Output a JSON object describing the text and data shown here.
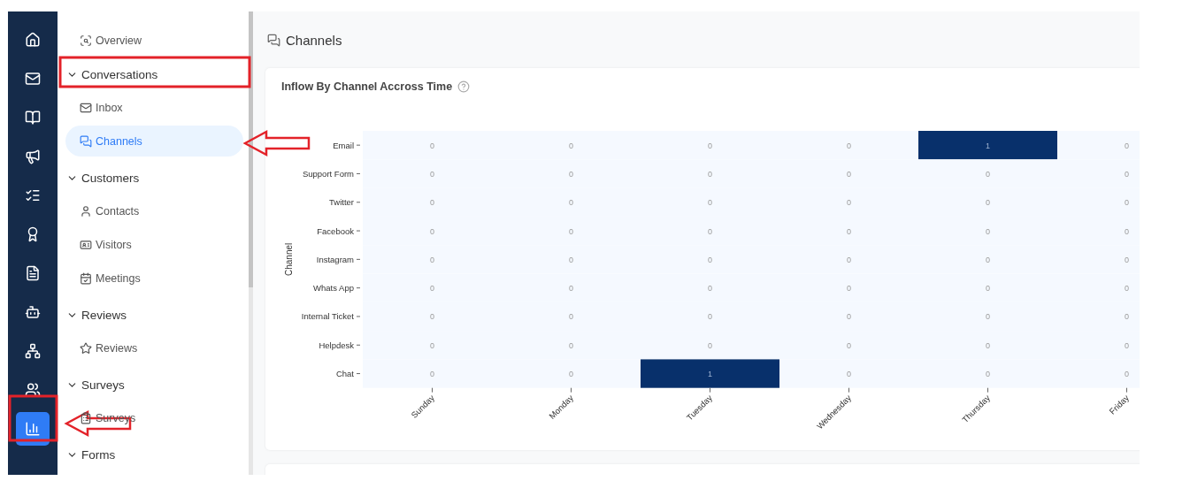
{
  "rail": {
    "items": [
      {
        "selected": false
      },
      {
        "selected": false
      },
      {
        "selected": false
      },
      {
        "selected": false
      },
      {
        "selected": false
      },
      {
        "selected": false
      },
      {
        "selected": false
      },
      {
        "selected": false
      },
      {
        "selected": false
      },
      {
        "selected": false
      },
      {
        "selected": true
      }
    ]
  },
  "sidebar": {
    "top_item": {
      "label": "Overview",
      "selected": false
    },
    "sections": [
      {
        "title": "Conversations",
        "expanded": true,
        "items": [
          {
            "label": "Inbox",
            "selected": false
          },
          {
            "label": "Channels",
            "selected": true
          }
        ]
      },
      {
        "title": "Customers",
        "expanded": true,
        "items": [
          {
            "label": "Contacts",
            "selected": false
          },
          {
            "label": "Visitors",
            "selected": false
          },
          {
            "label": "Meetings",
            "selected": false
          }
        ]
      },
      {
        "title": "Reviews",
        "expanded": true,
        "items": [
          {
            "label": "Reviews",
            "selected": false
          }
        ]
      },
      {
        "title": "Surveys",
        "expanded": true,
        "items": [
          {
            "label": "Surveys",
            "selected": false
          }
        ]
      },
      {
        "title": "Forms",
        "expanded": true
      }
    ]
  },
  "page": {
    "title": "Channels"
  },
  "card": {
    "title": "Inflow By Channel Accross Time",
    "heatmap": {
      "y_axis_title": "Channel",
      "x_axis_labels": [
        "Sunday",
        "Monday",
        "Tuesday",
        "Wednesday",
        "Thursday",
        "Friday"
      ],
      "rows": [
        {
          "label": "Email",
          "cells": [
            {
              "value": "0",
              "color": "#f5f9ff"
            },
            {
              "value": "0",
              "color": "#f5f9ff"
            },
            {
              "value": "0",
              "color": "#f5f9ff"
            },
            {
              "value": "0",
              "color": "#f5f9ff"
            },
            {
              "value": "1",
              "color": "#08306b"
            },
            {
              "value": "0",
              "color": "#f5f9ff"
            }
          ]
        },
        {
          "label": "Support Form",
          "cells": [
            {
              "value": "0",
              "color": "#f5f9ff"
            },
            {
              "value": "0",
              "color": "#f5f9ff"
            },
            {
              "value": "0",
              "color": "#f5f9ff"
            },
            {
              "value": "0",
              "color": "#f5f9ff"
            },
            {
              "value": "0",
              "color": "#f5f9ff"
            },
            {
              "value": "0",
              "color": "#f5f9ff"
            }
          ]
        },
        {
          "label": "Twitter",
          "cells": [
            {
              "value": "0",
              "color": "#f5f9ff"
            },
            {
              "value": "0",
              "color": "#f5f9ff"
            },
            {
              "value": "0",
              "color": "#f5f9ff"
            },
            {
              "value": "0",
              "color": "#f5f9ff"
            },
            {
              "value": "0",
              "color": "#f5f9ff"
            },
            {
              "value": "0",
              "color": "#f5f9ff"
            }
          ]
        },
        {
          "label": "Facebook",
          "cells": [
            {
              "value": "0",
              "color": "#f5f9ff"
            },
            {
              "value": "0",
              "color": "#f5f9ff"
            },
            {
              "value": "0",
              "color": "#f5f9ff"
            },
            {
              "value": "0",
              "color": "#f5f9ff"
            },
            {
              "value": "0",
              "color": "#f5f9ff"
            },
            {
              "value": "0",
              "color": "#f5f9ff"
            }
          ]
        },
        {
          "label": "Instagram",
          "cells": [
            {
              "value": "0",
              "color": "#f5f9ff"
            },
            {
              "value": "0",
              "color": "#f5f9ff"
            },
            {
              "value": "0",
              "color": "#f5f9ff"
            },
            {
              "value": "0",
              "color": "#f5f9ff"
            },
            {
              "value": "0",
              "color": "#f5f9ff"
            },
            {
              "value": "0",
              "color": "#f5f9ff"
            }
          ]
        },
        {
          "label": "Whats App",
          "cells": [
            {
              "value": "0",
              "color": "#f5f9ff"
            },
            {
              "value": "0",
              "color": "#f5f9ff"
            },
            {
              "value": "0",
              "color": "#f5f9ff"
            },
            {
              "value": "0",
              "color": "#f5f9ff"
            },
            {
              "value": "0",
              "color": "#f5f9ff"
            },
            {
              "value": "0",
              "color": "#f5f9ff"
            }
          ]
        },
        {
          "label": "Internal Ticket",
          "cells": [
            {
              "value": "0",
              "color": "#f5f9ff"
            },
            {
              "value": "0",
              "color": "#f5f9ff"
            },
            {
              "value": "0",
              "color": "#f5f9ff"
            },
            {
              "value": "0",
              "color": "#f5f9ff"
            },
            {
              "value": "0",
              "color": "#f5f9ff"
            },
            {
              "value": "0",
              "color": "#f5f9ff"
            }
          ]
        },
        {
          "label": "Helpdesk",
          "cells": [
            {
              "value": "0",
              "color": "#f5f9ff"
            },
            {
              "value": "0",
              "color": "#f5f9ff"
            },
            {
              "value": "0",
              "color": "#f5f9ff"
            },
            {
              "value": "0",
              "color": "#f5f9ff"
            },
            {
              "value": "0",
              "color": "#f5f9ff"
            },
            {
              "value": "0",
              "color": "#f5f9ff"
            }
          ]
        },
        {
          "label": "Chat",
          "cells": [
            {
              "value": "0",
              "color": "#f5f9ff"
            },
            {
              "value": "0",
              "color": "#f5f9ff"
            },
            {
              "value": "1",
              "color": "#08306b"
            },
            {
              "value": "0",
              "color": "#f5f9ff"
            },
            {
              "value": "0",
              "color": "#f5f9ff"
            },
            {
              "value": "0",
              "color": "#f5f9ff"
            }
          ]
        }
      ]
    }
  }
}
